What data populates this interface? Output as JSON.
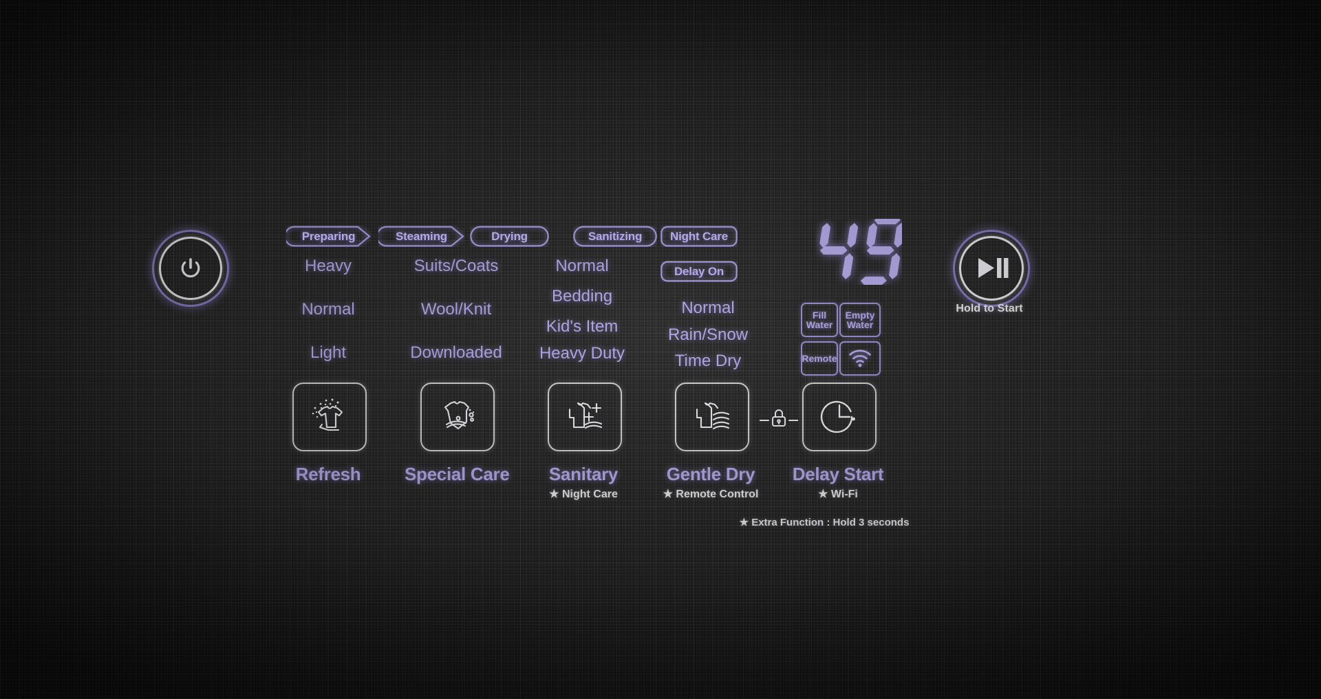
{
  "panel": {
    "device": "Clothing Care Control Panel",
    "accent_lavender": "#b3a9e6",
    "accent_white": "#e9e9ee",
    "background": "#262626"
  },
  "power_button": {
    "name": "Power",
    "icon": "power-icon"
  },
  "start_button": {
    "icon": "play-pause-icon",
    "label": "Hold to Start"
  },
  "stage_badges": [
    {
      "label": "Preparing",
      "shape": "chevron",
      "active": true
    },
    {
      "label": "Steaming",
      "shape": "chevron",
      "active": true
    },
    {
      "label": "Drying",
      "shape": "rounded",
      "active": true
    },
    {
      "label": "Sanitizing",
      "shape": "rounded",
      "active": true
    }
  ],
  "status_badges": [
    {
      "label": "Night Care",
      "shape": "rounded"
    },
    {
      "label": "Delay On",
      "shape": "rounded"
    }
  ],
  "option_columns": [
    {
      "name": "refresh-options",
      "items": [
        "Heavy",
        "Normal",
        "Light"
      ]
    },
    {
      "name": "special-care-options",
      "items": [
        "Suits/Coats",
        "Wool/Knit",
        "Downloaded"
      ]
    },
    {
      "name": "sanitary-options",
      "items": [
        "Normal",
        "Bedding",
        "Kid's Item",
        "Heavy Duty"
      ]
    },
    {
      "name": "gentle-dry-options",
      "items": [
        "Normal",
        "Rain/Snow",
        "Time Dry"
      ]
    }
  ],
  "display": {
    "value": "49",
    "digits": [
      "4",
      "9"
    ],
    "type": "seven-segment"
  },
  "indicators": [
    {
      "label": "Fill Water",
      "icon": null,
      "name": "fill-water-indicator"
    },
    {
      "label": "Empty Water",
      "icon": null,
      "name": "empty-water-indicator"
    },
    {
      "label": "Remote",
      "icon": null,
      "name": "remote-indicator"
    },
    {
      "label": "",
      "icon": "wifi-icon",
      "name": "wifi-indicator"
    }
  ],
  "cycle_buttons": [
    {
      "label": "Refresh",
      "icon": "shirt-sparkle-icon",
      "sub": ""
    },
    {
      "label": "Special Care",
      "icon": "shirt-bubbles-icon",
      "sub": ""
    },
    {
      "label": "Sanitary",
      "icon": "shirt-plus-icon",
      "sub": "★ Night Care"
    },
    {
      "label": "Gentle Dry",
      "icon": "shirt-waves-icon",
      "sub": "★ Remote Control"
    },
    {
      "label": "Delay Start",
      "icon": "clock-icon",
      "sub": "★ Wi-Fi"
    }
  ],
  "child_lock": {
    "icon": "lock-icon",
    "label": ""
  },
  "footnote": "★ Extra Function : Hold 3 seconds"
}
